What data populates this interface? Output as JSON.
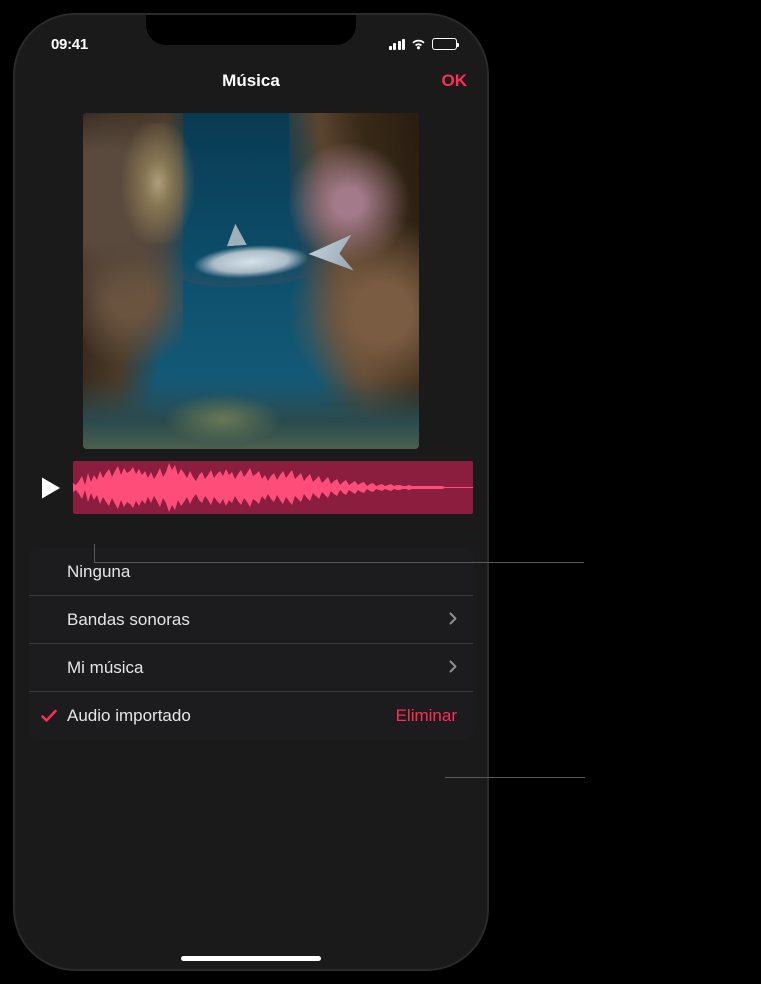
{
  "status": {
    "time": "09:41"
  },
  "nav": {
    "title": "Música",
    "done": "OK"
  },
  "list": {
    "none": "Ninguna",
    "soundtracks": "Bandas sonoras",
    "my_music": "Mi música",
    "imported": "Audio importado",
    "delete": "Eliminar"
  }
}
